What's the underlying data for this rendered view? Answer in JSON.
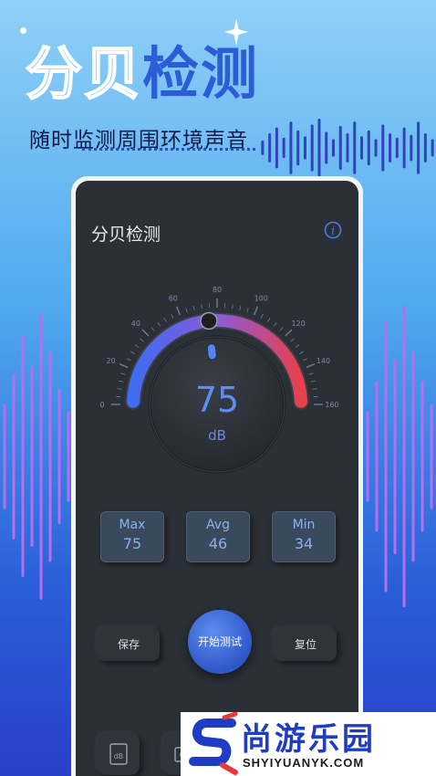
{
  "hero": {
    "title_part1": "分贝",
    "title_part2": "检测",
    "subtitle": "随时监测周围环境声音"
  },
  "app": {
    "title": "分贝检测",
    "info_icon": "info-icon"
  },
  "gauge": {
    "min": 0,
    "max": 160,
    "value": 75,
    "unit": "dB",
    "tick_labels": [
      "0",
      "20",
      "40",
      "60",
      "80",
      "100",
      "120",
      "140",
      "160"
    ],
    "colors": {
      "low": "#3f6cf0",
      "high": "#e8404c",
      "ticks": "#6e7c96"
    }
  },
  "stats": [
    {
      "label": "Max",
      "value": "75"
    },
    {
      "label": "Avg",
      "value": "46"
    },
    {
      "label": "Min",
      "value": "34"
    }
  ],
  "controls": {
    "save_label": "保存",
    "start_label": "开始测试",
    "reset_label": "复位"
  },
  "bottom_icons": [
    "db-icon",
    "camera-icon"
  ],
  "watermark": {
    "name": "尚游乐园",
    "url": "SHYIYUANYK.COM"
  },
  "colors": {
    "accent": "#2c5cd6",
    "app_bg": "#2b2f36",
    "stat_text": "#8bb1ea"
  }
}
